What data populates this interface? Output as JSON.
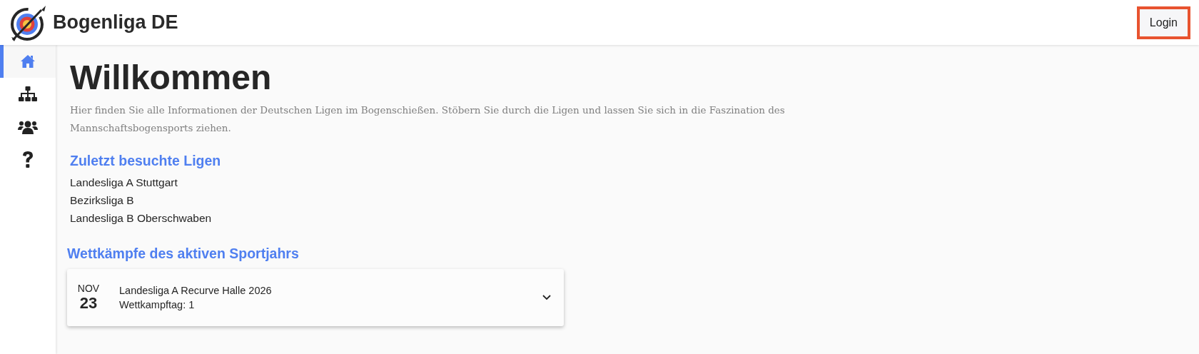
{
  "header": {
    "brand": "Bogenliga DE",
    "login": "Login"
  },
  "nav": [
    {
      "selected": true
    },
    {
      "selected": false
    },
    {
      "selected": false
    },
    {
      "selected": false
    }
  ],
  "welcome": {
    "title": "Willkommen",
    "text": "Hier finden Sie alle Informationen der Deutschen Ligen im Bogenschießen. Stöbern Sie durch die Ligen und lassen Sie sich in die Faszination des Mannschaftsbogensports ziehen."
  },
  "recent": {
    "heading": "Zuletzt besuchte Ligen",
    "items": [
      "Landesliga A Stuttgart",
      "Bezirksliga B",
      "Landesliga B Oberschwaben"
    ]
  },
  "events": {
    "heading": "Wettkämpfe des aktiven Sportjahrs",
    "items": [
      {
        "month": "NOV",
        "day": "23",
        "title": "Landesliga A Recurve Halle 2026",
        "subtitle": "Wettkampftag: 1",
        "expanded": false
      }
    ]
  }
}
